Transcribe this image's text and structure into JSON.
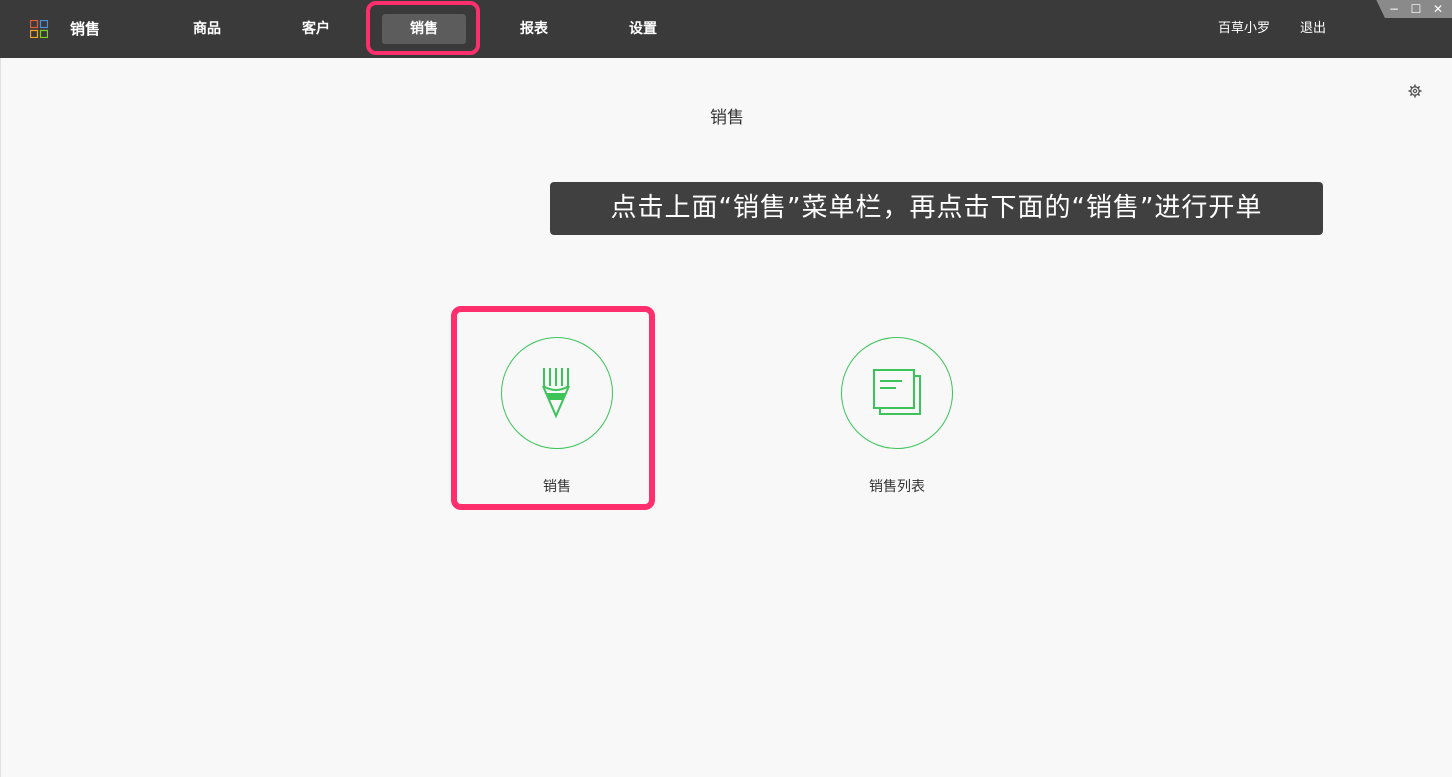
{
  "app": {
    "name": "销售"
  },
  "nav": {
    "items": [
      {
        "label": "商品",
        "active": false
      },
      {
        "label": "客户",
        "active": false
      },
      {
        "label": "销售",
        "active": true
      },
      {
        "label": "报表",
        "active": false
      },
      {
        "label": "设置",
        "active": false
      }
    ],
    "user": "百草小罗",
    "logout": "退出"
  },
  "window": {
    "minimize": "−",
    "maximize": "☐",
    "close": "✕"
  },
  "main": {
    "title": "销售",
    "tooltip": "点击上面“销售”菜单栏，再点击下面的“销售”进行开单",
    "tiles": [
      {
        "label": "销售",
        "icon": "pencil-icon"
      },
      {
        "label": "销售列表",
        "icon": "document-list-icon"
      }
    ]
  },
  "colors": {
    "topbar": "#3a3a3a",
    "accent_green": "#3cc45a",
    "highlight_pink": "#ff2f6e"
  }
}
